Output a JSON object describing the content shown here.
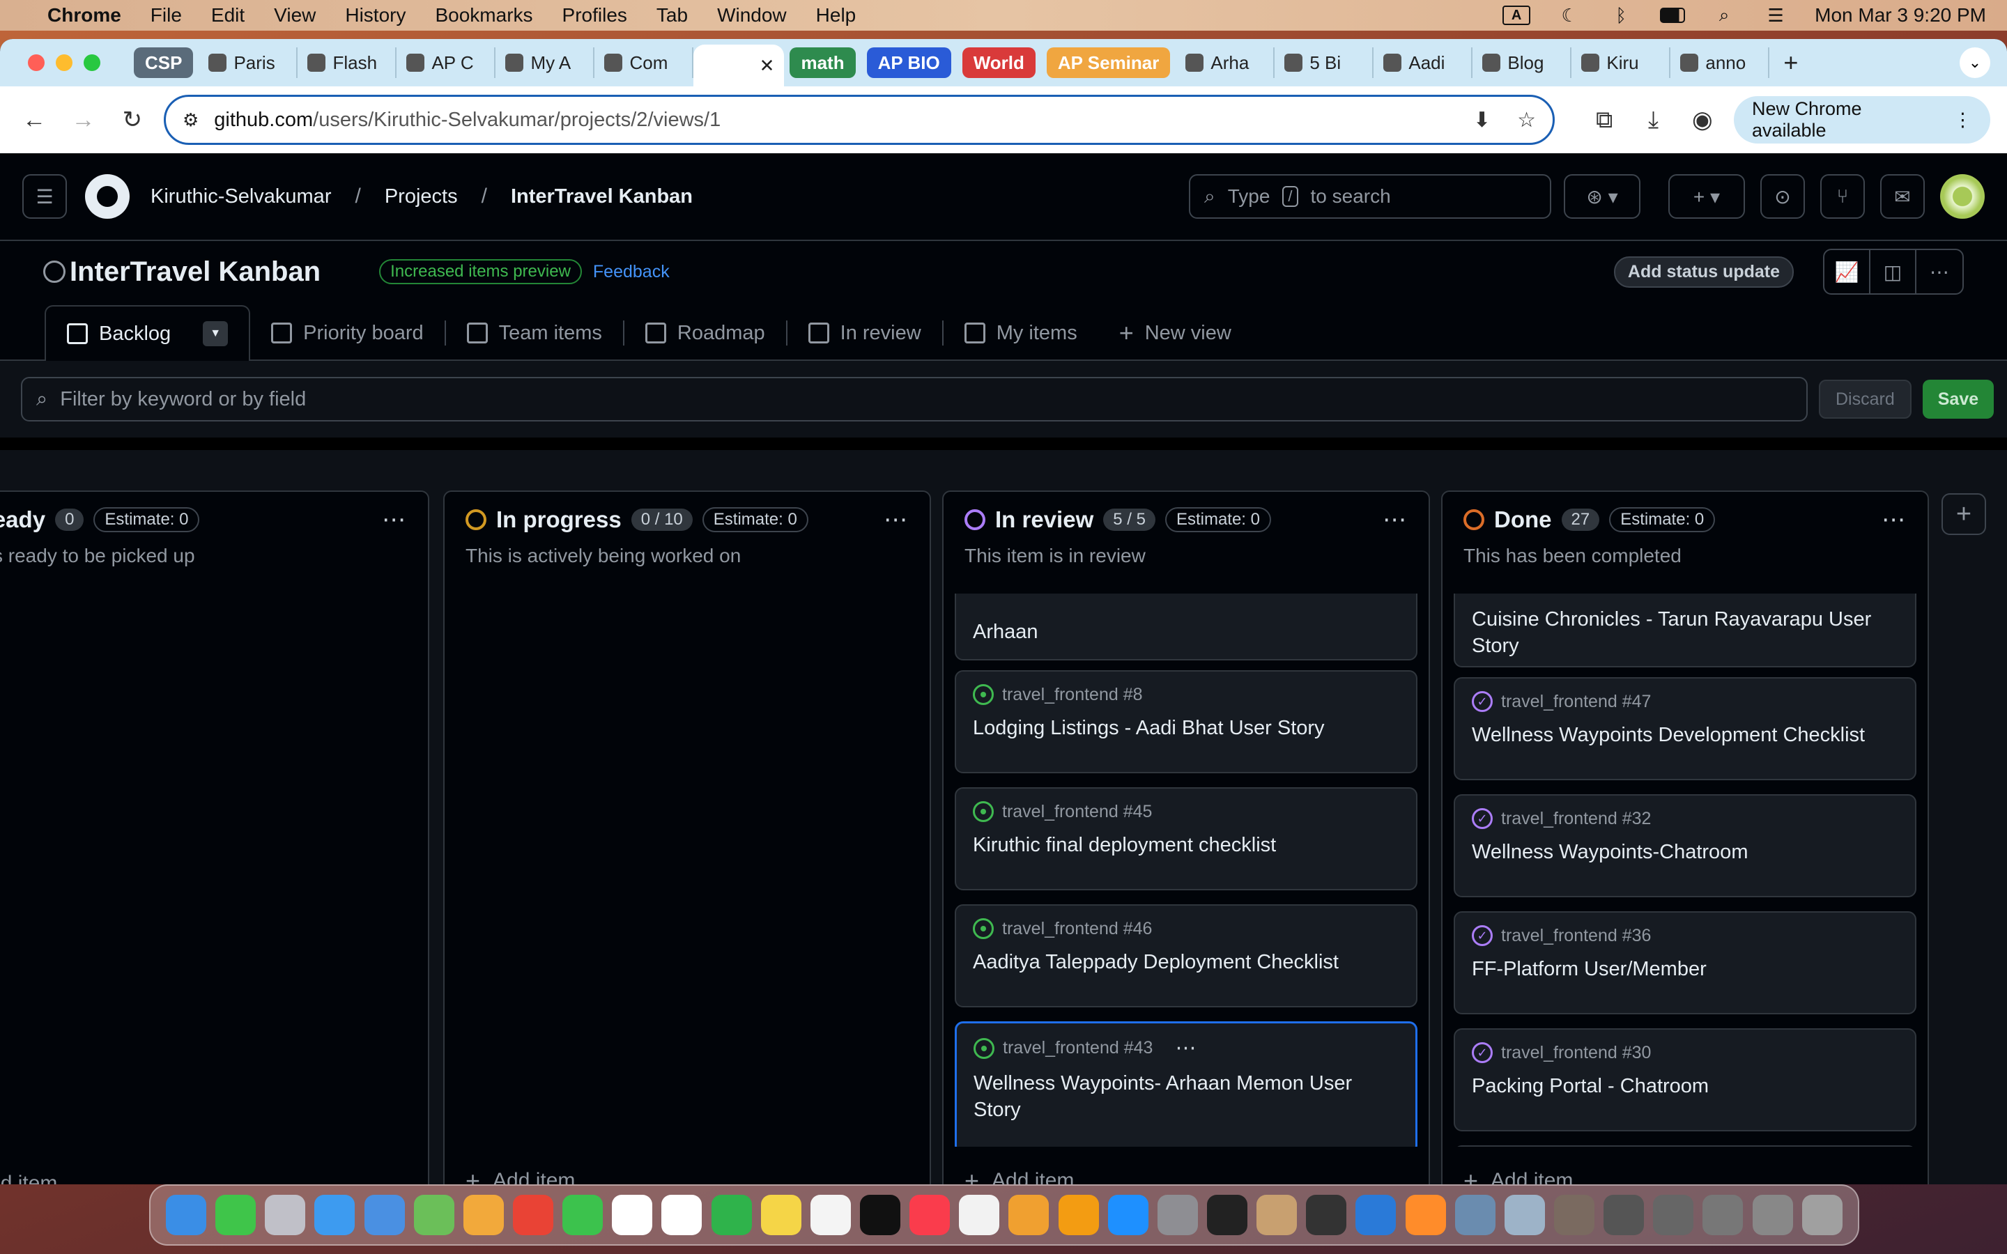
{
  "menubar": {
    "app": "Chrome",
    "items": [
      "File",
      "Edit",
      "View",
      "History",
      "Bookmarks",
      "Profiles",
      "Tab",
      "Window",
      "Help"
    ],
    "input_indicator": "A",
    "datetime": "Mon Mar 3  9:20 PM"
  },
  "tabs": [
    {
      "label": "CSP",
      "type": "group",
      "color": "#5a6b7a"
    },
    {
      "label": "Paris",
      "type": "tab"
    },
    {
      "label": "Flash",
      "type": "tab"
    },
    {
      "label": "AP C",
      "type": "tab"
    },
    {
      "label": "My A",
      "type": "tab"
    },
    {
      "label": "Com",
      "type": "tab"
    },
    {
      "label": "",
      "type": "active"
    },
    {
      "label": "math",
      "type": "group",
      "color": "#2e8b4e"
    },
    {
      "label": "AP BIO",
      "type": "group",
      "color": "#2a5bd7"
    },
    {
      "label": "World",
      "type": "group",
      "color": "#d93a3a"
    },
    {
      "label": "AP Seminar",
      "type": "group",
      "color": "#f0a640"
    },
    {
      "label": "Arha",
      "type": "tab"
    },
    {
      "label": "5 Bi",
      "type": "tab"
    },
    {
      "label": "Aadi",
      "type": "tab"
    },
    {
      "label": "Blog",
      "type": "tab"
    },
    {
      "label": "Kiru",
      "type": "tab"
    },
    {
      "label": "anno",
      "type": "tab"
    }
  ],
  "addressbar": {
    "host": "github.com",
    "path": "/users/Kiruthic-Selvakumar/projects/2/views/1",
    "new_chrome": "New Chrome available"
  },
  "github": {
    "breadcrumb": [
      "Kiruthic-Selvakumar",
      "Projects",
      "InterTravel Kanban"
    ],
    "search_prefix": "Type",
    "search_key": "/",
    "search_suffix": "to search"
  },
  "project": {
    "title": "InterTravel Kanban",
    "preview_badge": "Increased items preview",
    "feedback": "Feedback",
    "status_update": "Add status update"
  },
  "views": [
    "Backlog",
    "Priority board",
    "Team items",
    "Roadmap",
    "In review",
    "My items",
    "New view"
  ],
  "filter": {
    "placeholder": "Filter by keyword or by field",
    "discard": "Discard",
    "save": "Save"
  },
  "add_item_label": "Add item",
  "columns": [
    {
      "name": "Ready",
      "count": "0",
      "estimate": "Estimate: 0",
      "description": "s is ready to be picked up",
      "status_color": "",
      "cards": []
    },
    {
      "name": "In progress",
      "count": "0 / 10",
      "estimate": "Estimate: 0",
      "description": "This is actively being worked on",
      "status_color": "#d29922",
      "cards": []
    },
    {
      "name": "In review",
      "count": "5 / 5",
      "estimate": "Estimate: 0",
      "description": "This item is in review",
      "status_color": "#ab7df8",
      "cards": [
        {
          "ref": "",
          "title": "Arhaan",
          "state": "open"
        },
        {
          "ref": "travel_frontend #8",
          "title": "Lodging Listings - Aadi Bhat User Story",
          "state": "open"
        },
        {
          "ref": "travel_frontend #45",
          "title": "Kiruthic final deployment checklist",
          "state": "open"
        },
        {
          "ref": "travel_frontend #46",
          "title": "Aaditya Taleppady Deployment Checklist",
          "state": "open"
        },
        {
          "ref": "travel_frontend #43",
          "title": "Wellness Waypoints- Arhaan Memon User Story",
          "state": "open"
        }
      ]
    },
    {
      "name": "Done",
      "count": "27",
      "estimate": "Estimate: 0",
      "description": "This has been completed",
      "status_color": "#db6d28",
      "cards": [
        {
          "ref": "",
          "title": "Cuisine Chronicles - Tarun Rayavarapu User Story",
          "state": "done"
        },
        {
          "ref": "travel_frontend #47",
          "title": "Wellness Waypoints Development Checklist",
          "state": "done"
        },
        {
          "ref": "travel_frontend #32",
          "title": "Wellness Waypoints-Chatroom",
          "state": "done"
        },
        {
          "ref": "travel_frontend #36",
          "title": "FF-Platform User/Member",
          "state": "done"
        },
        {
          "ref": "travel_frontend #30",
          "title": "Packing Portal - Chatroom",
          "state": "done"
        }
      ]
    }
  ],
  "dock": [
    "finder-icon",
    "messages-icon",
    "launchpad-icon",
    "safari-icon",
    "mail-icon",
    "maps-icon",
    "photos-icon",
    "chrome-icon",
    "facetime-icon",
    "calendar-icon",
    "reminders-icon",
    "numbers-icon",
    "notes-icon",
    "freeform-icon",
    "tv-icon",
    "music-icon",
    "news-icon",
    "keynote-icon",
    "pages-icon",
    "appstore-icon",
    "settings-icon",
    "terminal-icon",
    "contacts-icon",
    "unity-icon",
    "vscode-icon",
    "pencil-icon",
    "quicktime-icon",
    "preview-icon",
    "folder1-icon",
    "folder2-icon",
    "folder3-icon",
    "folder4-icon",
    "folder5-icon",
    "trash-icon"
  ]
}
